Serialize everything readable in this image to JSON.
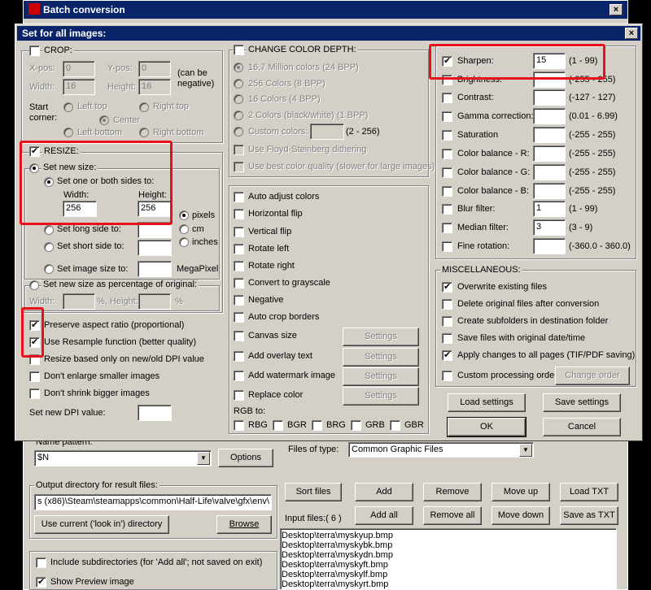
{
  "main_window": {
    "title": "Batch conversion",
    "close": "×"
  },
  "dialog": {
    "title": "Set for all images:",
    "close": "×"
  },
  "crop": {
    "label": "CROP:",
    "xpos_label": "X-pos:",
    "xpos": "0",
    "ypos_label": "Y-pos:",
    "ypos": "0",
    "can_be_neg": "(can be",
    "negative": "negative)",
    "width_label": "Width:",
    "width": "16",
    "height_label": "Height:",
    "height": "16",
    "start_label": "Start",
    "corner_label": "corner:",
    "left_top": "Left top",
    "right_top": "Right top",
    "center": "Center",
    "left_bottom": "Left bottom",
    "right_bottom": "Right bottom"
  },
  "resize": {
    "label": "RESIZE:",
    "set_new_size": "Set new size:",
    "one_or_both": "Set one or both sides to:",
    "width_label": "Width:",
    "height_label": "Height:",
    "width": "256",
    "height": "256",
    "pixels": "pixels",
    "cm": "cm",
    "inches": "inches",
    "long_side": "Set long side to:",
    "short_side": "Set short side to:",
    "image_size": "Set image size to:",
    "megapixel": "MegaPixel",
    "percent": "Set new size as percentage of original:",
    "pct_width": "Width:",
    "pct_height": "%, Height:",
    "pct_unit": "%"
  },
  "options": {
    "preserve": "Preserve aspect ratio (proportional)",
    "resample": "Use Resample function (better quality)",
    "dpi_based": "Resize based only on new/old DPI value",
    "no_enlarge": "Don't enlarge smaller images",
    "no_shrink": "Don't shrink bigger images",
    "dpi_label": "Set new DPI value:"
  },
  "color_depth": {
    "label": "CHANGE COLOR DEPTH:",
    "items": [
      "16,7 Million colors (24 BPP)",
      "256 Colors (8 BPP)",
      "16 Colors (4 BPP)",
      "2 Colors (black/white) (1 BPP)",
      "Custom colors:"
    ],
    "custom_range": "(2 - 256)",
    "floyd": "Use Floyd-Steinberg dithering",
    "best_quality": "Use best color quality (slower for large images)"
  },
  "effects": {
    "auto_adjust": "Auto adjust colors",
    "hflip": "Horizontal flip",
    "vflip": "Vertical flip",
    "rotate_left": "Rotate left",
    "rotate_right": "Rotate right",
    "grayscale": "Convert to grayscale",
    "negative": "Negative",
    "auto_crop": "Auto crop borders",
    "canvas": "Canvas size",
    "overlay": "Add overlay text",
    "watermark": "Add watermark image",
    "replace": "Replace color",
    "settings": "Settings",
    "rgb_to": "RGB to:",
    "rgb_opts": [
      "RBG",
      "BGR",
      "BRG",
      "GRB",
      "GBR"
    ]
  },
  "adjust": [
    {
      "label": "Sharpen:",
      "value": "15",
      "range": "(1  -  99)",
      "checked": true
    },
    {
      "label": "Brightness:",
      "value": "",
      "range": "(-255  -  255)",
      "checked": false
    },
    {
      "label": "Contrast:",
      "value": "",
      "range": "(-127  -  127)",
      "checked": false
    },
    {
      "label": "Gamma correction:",
      "value": "",
      "range": "(0.01  -  6.99)",
      "checked": false
    },
    {
      "label": "Saturation",
      "value": "",
      "range": "(-255  -  255)",
      "checked": false
    },
    {
      "label": "Color balance - R:",
      "value": "",
      "range": "(-255  -  255)",
      "checked": false
    },
    {
      "label": "Color balance - G:",
      "value": "",
      "range": "(-255  -  255)",
      "checked": false
    },
    {
      "label": "Color balance - B:",
      "value": "",
      "range": "(-255  -  255)",
      "checked": false
    },
    {
      "label": "Blur filter:",
      "value": "1",
      "range": "(1  -  99)",
      "checked": false
    },
    {
      "label": "Median filter:",
      "value": "3",
      "range": "(3  -  9)",
      "checked": false
    },
    {
      "label": "Fine rotation:",
      "value": "",
      "range": "(-360.0  -  360.0)",
      "checked": false
    }
  ],
  "misc": {
    "label": "MISCELLANEOUS:",
    "overwrite": "Overwrite existing files",
    "delete_orig": "Delete original files after conversion",
    "subfolders": "Create subfolders in destination folder",
    "save_date": "Save files with original date/time",
    "apply_all": "Apply changes to all pages (TIF/PDF saving)",
    "custom_order": "Custom processing order",
    "change_order": "Change order"
  },
  "buttons": {
    "load": "Load settings",
    "save": "Save settings",
    "ok": "OK",
    "cancel": "Cancel"
  },
  "bg": {
    "name_pattern_label": "Name pattern:",
    "name_pattern": "$N",
    "options": "Options",
    "files_of_type_label": "Files of type:",
    "files_of_type": "Common Graphic Files",
    "output_label": "Output directory for result files:",
    "output_path": "s (x86)\\Steam\\steamapps\\common\\Half-Life\\valve\\gfx\\env\\",
    "use_current": "Use current ('look in') directory",
    "browse": "Browse",
    "sort": "Sort files",
    "add": "Add",
    "remove": "Remove",
    "move_up": "Move up",
    "load_txt": "Load TXT",
    "add_all": "Add all",
    "remove_all": "Remove all",
    "move_down": "Move down",
    "save_txt": "Save as TXT",
    "input_files": "Input files:( 6 )",
    "files": [
      "Desktop\\terra\\myskyup.bmp",
      "Desktop\\terra\\myskybk.bmp",
      "Desktop\\terra\\myskydn.bmp",
      "Desktop\\terra\\myskyft.bmp",
      "Desktop\\terra\\myskylf.bmp",
      "Desktop\\terra\\myskyrt.bmp"
    ],
    "include_sub": "Include subdirectories (for 'Add all'; not saved on exit)",
    "show_preview": "Show Preview image"
  }
}
